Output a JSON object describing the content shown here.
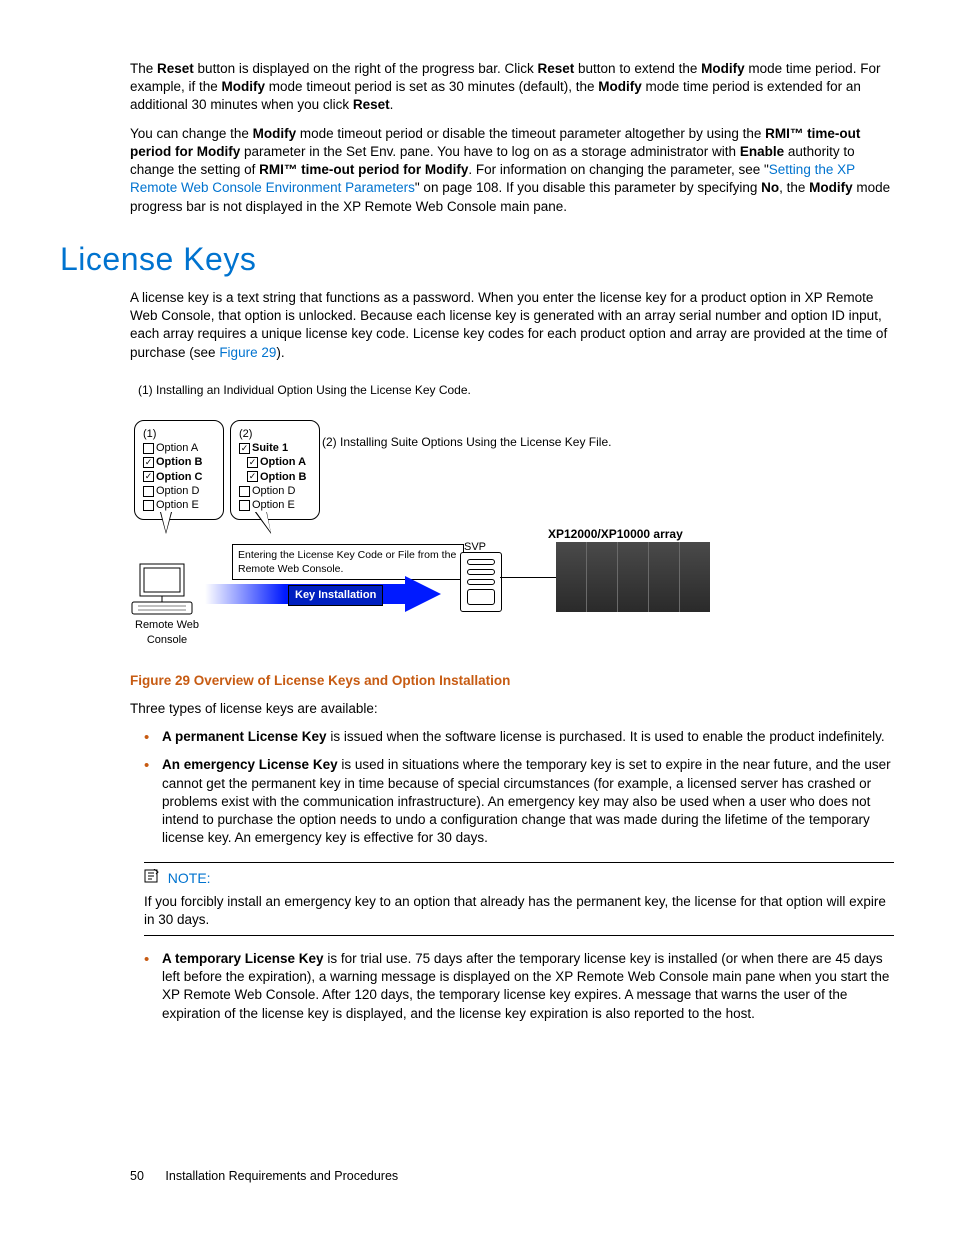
{
  "para1": {
    "t1": "The ",
    "b1": "Reset",
    "t2": " button is displayed on the right of the progress bar.  Click ",
    "b2": "Reset",
    "t3": " button to extend the ",
    "b3": "Modify",
    "t4": " mode time period.  For example, if the ",
    "b4": "Modify",
    "t5": " mode timeout period is set as 30 minutes (default), the ",
    "b5": "Modify",
    "t6": " mode time period is extended for an additional 30 minutes when you click ",
    "b6": "Reset",
    "t7": "."
  },
  "para2": {
    "t1": "You can change the ",
    "b1": "Modify",
    "t2": " mode timeout period or disable the timeout parameter altogether by using the ",
    "b2": "RMI™ time-out period for Modify",
    "t3": " parameter in the Set Env.  pane.  You have to log on as a storage administrator with ",
    "b3": "Enable",
    "t4": " authority to change the setting of ",
    "b4": "RMI™ time-out period for Modify",
    "t5": ".  For information on changing the parameter, see \"",
    "link": "Setting the XP Remote Web Console Environment Parameters",
    "t6": "\" on page 108.  If you disable this parameter by specifying ",
    "b5": "No",
    "t7": ", the ",
    "b6": "Modify",
    "t8": " mode progress bar is not displayed in the XP Remote Web Console main pane."
  },
  "heading": "License Keys",
  "para3": {
    "t1": "A license key is a text string that functions as a password.  When you enter the license key for a product option in XP Remote Web Console, that option is unlocked.  Because each license key is generated with an array serial number and option ID input, each array requires a unique license key code.  License key codes for each product option and array are provided at the time of purchase (see ",
    "link": "Figure 29",
    "t2": ")."
  },
  "figure": {
    "label_top": "(1) Installing an Individual Option Using the License Key Code.",
    "label_right": "(2) Installing Suite Options Using the License Key File.",
    "bubble1": {
      "head": "(1)",
      "items": [
        "Option A",
        "Option B",
        "Option C",
        "Option D",
        "Option E"
      ],
      "checked": [
        false,
        true,
        true,
        false,
        false
      ]
    },
    "bubble2": {
      "head": "(2)",
      "suite": "Suite 1",
      "items": [
        "Option A",
        "Option B",
        "Option D",
        "Option E"
      ],
      "checked": [
        true,
        true,
        false,
        false
      ]
    },
    "enter_box": "Entering the License Key Code or File from the Remote Web Console.",
    "rwc": "Remote Web Console",
    "key_install": "Key Installation",
    "svp": "SVP",
    "array_label": "XP12000/XP10000 array"
  },
  "figure_caption": "Figure 29 Overview of License Keys and Option Installation",
  "para4": "Three types of license keys are available:",
  "bullets": {
    "perm": {
      "b": "A permanent License Key",
      "t": " is issued when the software license is purchased.  It is used to enable the product indefinitely."
    },
    "emerg": {
      "b": "An emergency License Key",
      "t": " is used in situations where the temporary key is set to expire in the near future, and the user cannot get the permanent key in time because of special circumstances (for example, a licensed server has crashed or problems exist with the communication infrastructure).  An emergency key may also be used when a user who does not intend to purchase the option needs to undo a configuration change that was made during the lifetime of the temporary license key.  An emergency key is effective for 30 days."
    },
    "temp": {
      "b": "A temporary License Key",
      "t": " is for trial use.  75 days after the temporary license key is installed (or when there are 45 days left before the expiration), a warning message is displayed on the XP Remote Web Console main pane when you start the XP Remote Web Console.  After 120 days, the temporary license key expires.  A message that warns the user of the expiration of the license key is displayed, and the license key expiration is also reported to the host."
    }
  },
  "note": {
    "head": "NOTE:",
    "body": "If you forcibly install an emergency key to an option that already has the permanent key, the license for that option will expire in 30 days."
  },
  "footer": {
    "page": "50",
    "title": "Installation Requirements and Procedures"
  }
}
